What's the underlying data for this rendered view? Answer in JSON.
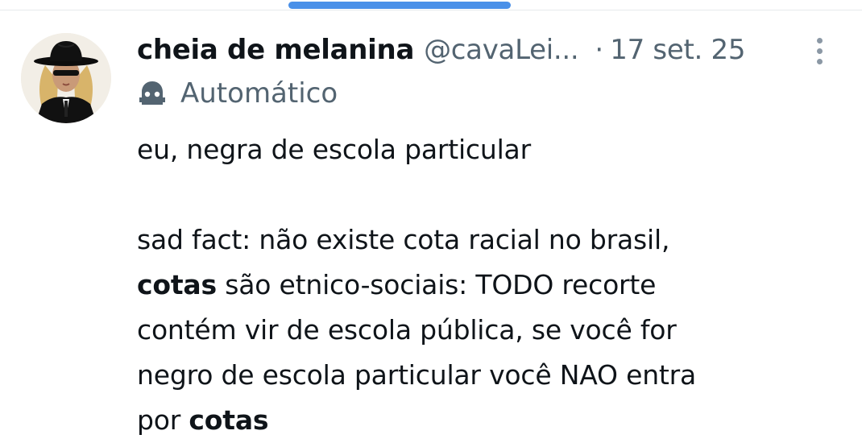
{
  "tweet": {
    "author": {
      "display_name": "cheia de melanina",
      "handle": "@cavaLei...",
      "avatar_icon": "profile-photo-avatar"
    },
    "separator": "·",
    "date": "17 set. 25",
    "automated_label": "Automático",
    "automated_icon": "bot-icon",
    "more_icon": "more-vertical-icon",
    "body": {
      "line1": "eu, negra de escola particular",
      "line2": "sad fact: não existe cota racial no brasil,",
      "line3_bold": "cotas",
      "line3_rest": " são etnico-sociais: TODO recorte",
      "line4": "contém vir de escola pública, se você for",
      "line5": "negro de escola particular você NAO entra",
      "line6_start": "por ",
      "line6_bold": "cotas"
    }
  },
  "colors": {
    "primary_text": "#0f1419",
    "secondary_text": "#536471",
    "scroll_indicator": "#4a90e8",
    "divider": "#e6e9ec"
  }
}
